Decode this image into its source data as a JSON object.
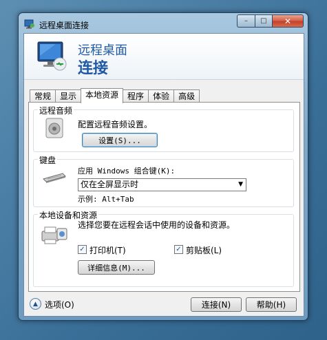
{
  "window": {
    "title": "远程桌面连接",
    "caption_min": "–",
    "caption_max": "□",
    "caption_close": "✕"
  },
  "banner": {
    "line1": "远程桌面",
    "line2": "连接"
  },
  "tabs": [
    {
      "label": "常规"
    },
    {
      "label": "显示"
    },
    {
      "label": "本地资源",
      "active": true
    },
    {
      "label": "程序"
    },
    {
      "label": "体验"
    },
    {
      "label": "高级"
    }
  ],
  "audio": {
    "group_label": "远程音频",
    "description": "配置远程音频设置。",
    "settings_button": "设置(S)..."
  },
  "keyboard": {
    "group_label": "键盘",
    "apply_label": "应用 Windows 组合键(K):",
    "selected_option": "仅在全屏显示时",
    "example": "示例: Alt+Tab"
  },
  "local_devices": {
    "group_label": "本地设备和资源",
    "description": "选择您要在远程会话中使用的设备和资源。",
    "printer": {
      "label": "打印机(T)",
      "checked": true
    },
    "clipboard": {
      "label": "剪贴板(L)",
      "checked": true
    },
    "details_button": "详细信息(M)..."
  },
  "footer": {
    "options_label": "选项(O)",
    "connect_button": "连接(N)",
    "help_button": "帮助(H)"
  },
  "colors": {
    "banner_text": "#1f5aa6",
    "close_button": "#c2412a"
  },
  "icons": {
    "check": "✓",
    "dropdown_arrow": "▼",
    "options_arrow": "▲"
  }
}
